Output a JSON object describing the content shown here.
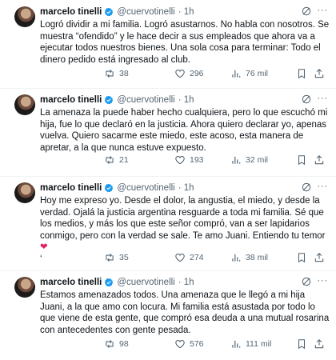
{
  "tweets": [
    {
      "name": "marcelo tinelli",
      "handle": "@cuervotinelli",
      "time": "· 1h",
      "text": "Logró dividir a mi familia. Logró asustarnos. No habla con nosotros. Se muestra “ofendido” y le hace decir a sus empleados que ahora va a ejecutar todos nuestros bienes. Una sola cosa para terminar: Todo el dinero pedido está ingresado al club.",
      "retweets": "38",
      "likes": "296",
      "views": "76 mil"
    },
    {
      "name": "marcelo tinelli",
      "handle": "@cuervotinelli",
      "time": "· 1h",
      "text": "La amenaza la puede haber hecho cualquiera, pero lo que  escuchó mi hija, fue lo que declaró en la justicia. Ahora quiero declarar yo, apenas vuelva. Quiero sacarme este miedo, este acoso, esta manera de apretar, a la que nunca estuve expuesto.",
      "retweets": "21",
      "likes": "193",
      "views": "32 mil"
    },
    {
      "name": "marcelo tinelli",
      "handle": "@cuervotinelli",
      "time": "· 1h",
      "text": "Hoy me expreso yo. Desde el dolor, la angustia, el miedo, y desde la verdad. Ojalá la justicia argentina resguarde a toda mi familia. Sé que los medios, y más los que este señor compró, van a ser lapidarios conmigo, pero con la verdad se sale. Te amo Juani. Entiendo tu temor",
      "text_heart": "❤",
      "text_tail": "‘",
      "retweets": "35",
      "likes": "274",
      "views": "38 mil"
    },
    {
      "name": "marcelo tinelli",
      "handle": "@cuervotinelli",
      "time": "· 1h",
      "text": "Estamos amenazados todos. Una amenaza que le llegó a mi hija Juani, a la que amo con locura. Mi familia está asustada por todo lo que viene de esta gente, que compró esa deuda a una mutual rosarina con antecedentes con gente pesada.",
      "retweets": "98",
      "likes": "576",
      "views": "111 mil"
    }
  ],
  "colors": {
    "verified": "#1d9bf0",
    "secondary_text": "#536471",
    "heart_emoji": "#e0245e"
  },
  "icons": [
    "verified-badge-icon",
    "grok-icon",
    "more-icon",
    "reply-icon",
    "retweet-icon",
    "like-icon",
    "views-icon",
    "bookmark-icon",
    "share-icon"
  ]
}
